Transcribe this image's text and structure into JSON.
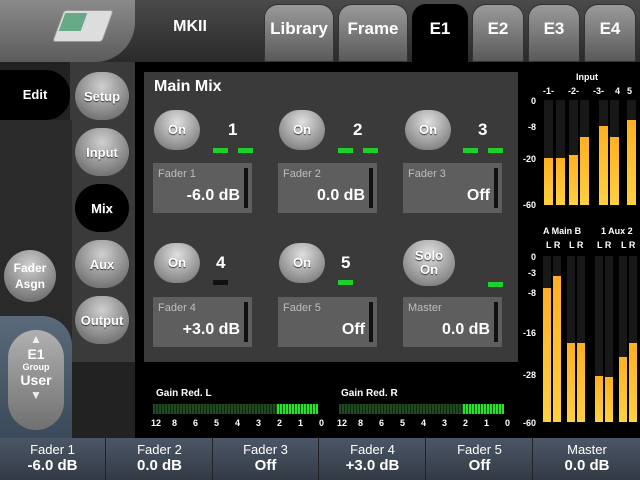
{
  "header": {
    "title": "MKII",
    "tabs": [
      {
        "label": "Library"
      },
      {
        "label": "Frame"
      },
      {
        "label": "E1"
      },
      {
        "label": "E2"
      },
      {
        "label": "E3"
      },
      {
        "label": "E4"
      }
    ],
    "active_tab": "E1"
  },
  "left_nav": {
    "edit_label": "Edit",
    "buttons": [
      {
        "label": "Setup"
      },
      {
        "label": "Input"
      },
      {
        "label": "Mix"
      },
      {
        "label": "Aux"
      },
      {
        "label": "Output"
      }
    ],
    "active": "Mix",
    "fader_assign_label": "Fader\nAsgn",
    "group": {
      "engine": "E1",
      "label": "Group",
      "value": "User"
    }
  },
  "main_mix": {
    "title": "Main Mix",
    "on_label": "On",
    "channels": [
      {
        "number": "1",
        "fader_label": "Fader 1",
        "value": "-6.0 dB"
      },
      {
        "number": "2",
        "fader_label": "Fader 2",
        "value": "0.0 dB"
      },
      {
        "number": "3",
        "fader_label": "Fader 3",
        "value": "Off"
      },
      {
        "number": "4",
        "fader_label": "Fader 4",
        "value": "+3.0 dB"
      },
      {
        "number": "5",
        "fader_label": "Fader 5",
        "value": "Off"
      }
    ],
    "solo_label": "Solo",
    "solo_state": "On",
    "master": {
      "label": "Master",
      "value": "0.0 dB"
    }
  },
  "gain_reduction": {
    "left_label": "Gain Red. L",
    "right_label": "Gain Red. R",
    "scale": [
      "12",
      "8",
      "6",
      "5",
      "4",
      "3",
      "2",
      "1",
      "0"
    ],
    "left_level": 0.25,
    "right_level": 0.25
  },
  "meters": {
    "input": {
      "title": "Input",
      "channels": [
        "-1-",
        "-2-",
        "-3-",
        "4",
        "5"
      ],
      "ticks": [
        "0",
        "-8",
        "-20",
        "-60"
      ],
      "levels": [
        -20,
        -20,
        -19,
        -12,
        -8,
        -12,
        -6
      ]
    },
    "output": {
      "labels_top": [
        "A Main B",
        "1 Aux 2"
      ],
      "labels_lr": [
        "L R",
        "L R",
        "L R",
        "L R"
      ],
      "ticks": [
        "0",
        "-3",
        "-8",
        "-16",
        "-28",
        "-60"
      ],
      "levels": [
        -7,
        -4,
        -19,
        -19,
        -29,
        -30,
        -23,
        -19
      ]
    }
  },
  "bottom": {
    "cells": [
      {
        "label": "Fader 1",
        "value": "-6.0 dB"
      },
      {
        "label": "Fader 2",
        "value": "0.0 dB"
      },
      {
        "label": "Fader 3",
        "value": "Off"
      },
      {
        "label": "Fader 4",
        "value": "+3.0 dB"
      },
      {
        "label": "Fader 5",
        "value": "Off"
      },
      {
        "label": "Master",
        "value": "0.0 dB"
      }
    ]
  }
}
